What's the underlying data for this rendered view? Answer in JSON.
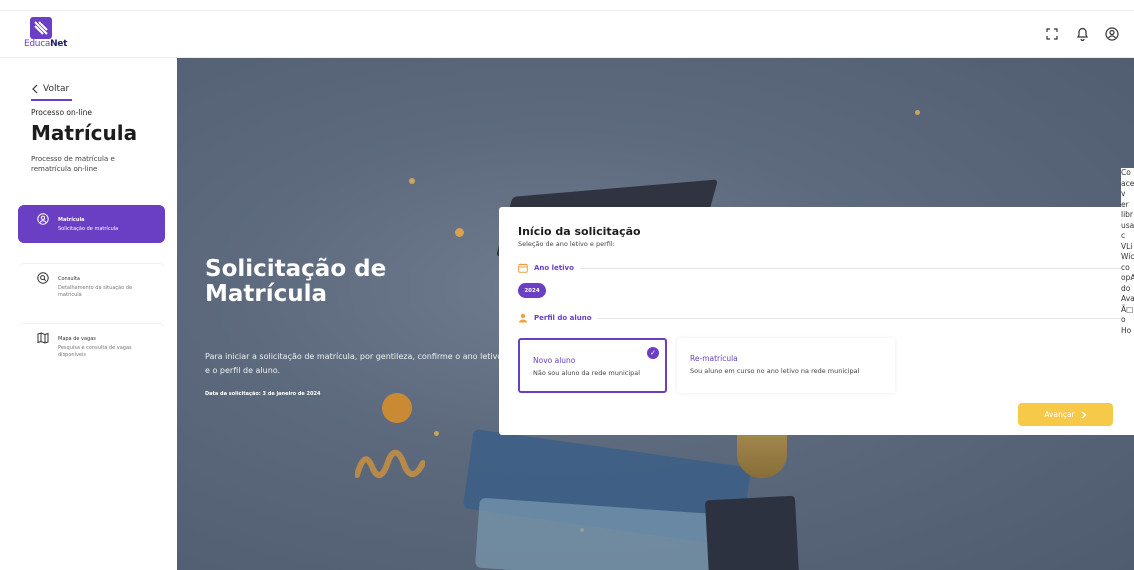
{
  "brand": {
    "logo_part1": "Educa",
    "logo_part2": "Net"
  },
  "header": {
    "icons": [
      "expand-icon",
      "bell-icon",
      "user-circle-icon"
    ]
  },
  "sidebar": {
    "back_label": "Voltar",
    "process_label": "Processo on-line",
    "title": "Matrícula",
    "description": "Processo de matrícula e rematrícula on-line",
    "items": [
      {
        "title": "Matrícula",
        "subtitle": "Solicitação de matrícula",
        "icon": "user-circle-icon",
        "active": true
      },
      {
        "title": "Consulta",
        "subtitle": "Detalhamento da situação de matrícula",
        "icon": "search-icon",
        "active": false
      },
      {
        "title": "Mapa de vagas",
        "subtitle": "Pesquisa e consulta de vagas disponíveis",
        "icon": "map-icon",
        "active": false
      }
    ]
  },
  "hero": {
    "title": "Solicitação de Matrícula",
    "text": "Para iniciar a solicitação de matrícula, por gentileza, confirme o ano letivo e o perfil de aluno.",
    "date": "Data da solicitação: 3 de janeiro de 2024"
  },
  "card": {
    "title": "Início da solicitação",
    "subtitle": "Seleção de ano letivo e perfil:",
    "year_section": "Ano letivo",
    "year_value": "2024",
    "profile_section": "Perfil do aluno",
    "options": [
      {
        "title": "Novo aluno",
        "desc": "Não sou aluno da rede municipal",
        "selected": true
      },
      {
        "title": "Re-matrícula",
        "desc": "Sou aluno em curso no ano letivo na rede municipal",
        "selected": false
      }
    ],
    "next_label": "Avançar"
  },
  "broken_text": "Co\nace\nv\ner\nlibr\nusa\nc\nVLi\nWic\nco\nopA\ndo\nAva\nÃ□\no\nHo"
}
